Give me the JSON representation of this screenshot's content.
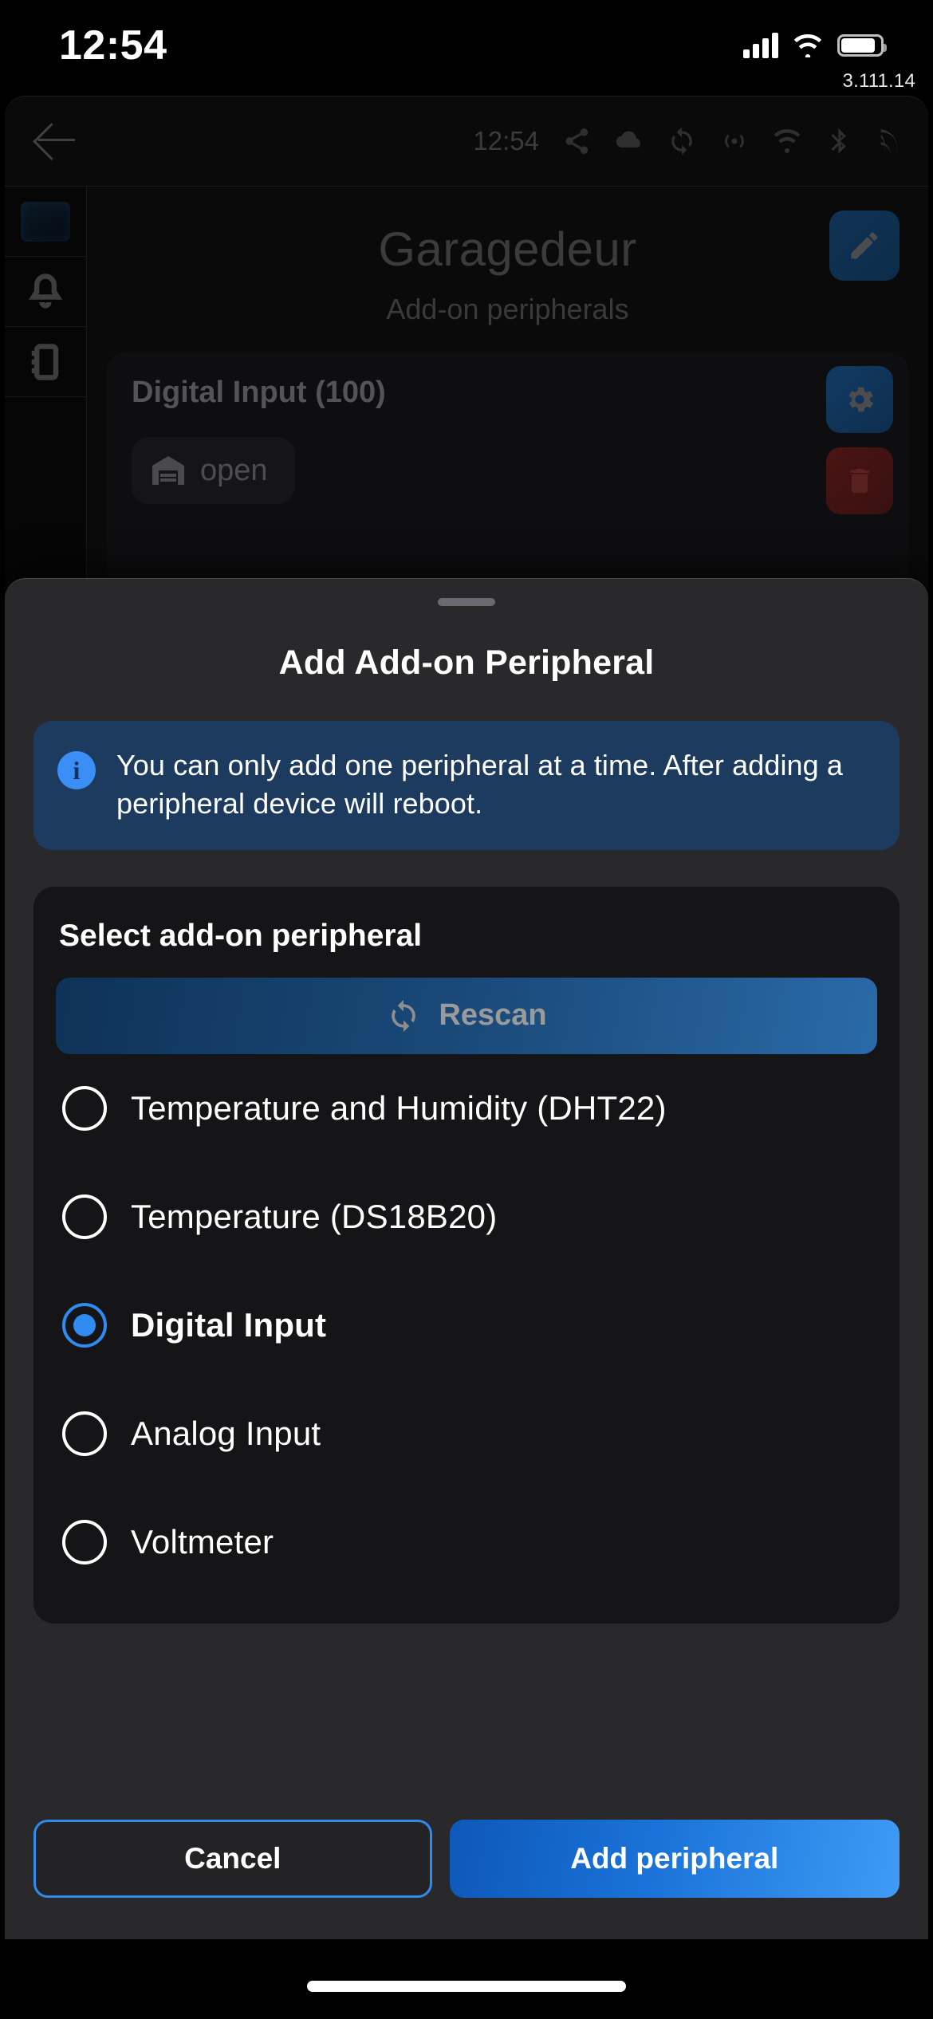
{
  "status_bar": {
    "time": "12:54",
    "cellular_icon": "signal-bars-icon",
    "wifi_icon": "wifi-icon",
    "battery_icon": "battery-icon"
  },
  "version_label": "3.111.14",
  "app": {
    "back_icon": "back-arrow-icon",
    "top_time": "12:54",
    "top_icons": [
      "share-icon",
      "cloud-icon",
      "sync-icon",
      "broadcast-icon",
      "wifi-icon",
      "bluetooth-icon",
      "signal-icon"
    ],
    "rail": {
      "device_thumbnail": "shelly-device-image",
      "items": [
        {
          "icon": "bell-icon",
          "name": "notifications"
        },
        {
          "icon": "device-board-icon",
          "name": "peripherals"
        }
      ]
    },
    "title": "Garagedeur",
    "edit_icon": "pencil-icon",
    "subtitle": "Add-on peripherals",
    "peripheral_card": {
      "title": "Digital Input (100)",
      "settings_icon": "gear-icon",
      "delete_icon": "trash-icon",
      "state_icon": "garage-door-icon",
      "state_label": "open"
    }
  },
  "sheet": {
    "grabber": "drag-handle",
    "title": "Add Add-on Peripheral",
    "info": {
      "icon": "info-icon",
      "text": "You can only add one peripheral at a time. After adding a peripheral device will reboot."
    },
    "selector": {
      "heading": "Select add-on peripheral",
      "rescan": {
        "label": "Rescan",
        "icon": "refresh-icon"
      },
      "options": [
        {
          "label": "Temperature and Humidity (DHT22)",
          "selected": false
        },
        {
          "label": "Temperature (DS18B20)",
          "selected": false
        },
        {
          "label": "Digital Input",
          "selected": true
        },
        {
          "label": "Analog Input",
          "selected": false
        },
        {
          "label": "Voltmeter",
          "selected": false
        }
      ]
    },
    "actions": {
      "cancel_label": "Cancel",
      "confirm_label": "Add peripheral"
    }
  },
  "colors": {
    "accent_blue": "#2f8bf0",
    "info_bg": "#1d3a5f",
    "info_icon": "#3b8ef5",
    "sheet_bg": "#29292b",
    "card_bg": "#151518",
    "primary_button_start": "#0d58b8",
    "primary_button_end": "#3f9bf5"
  },
  "home_indicator": "home-indicator"
}
